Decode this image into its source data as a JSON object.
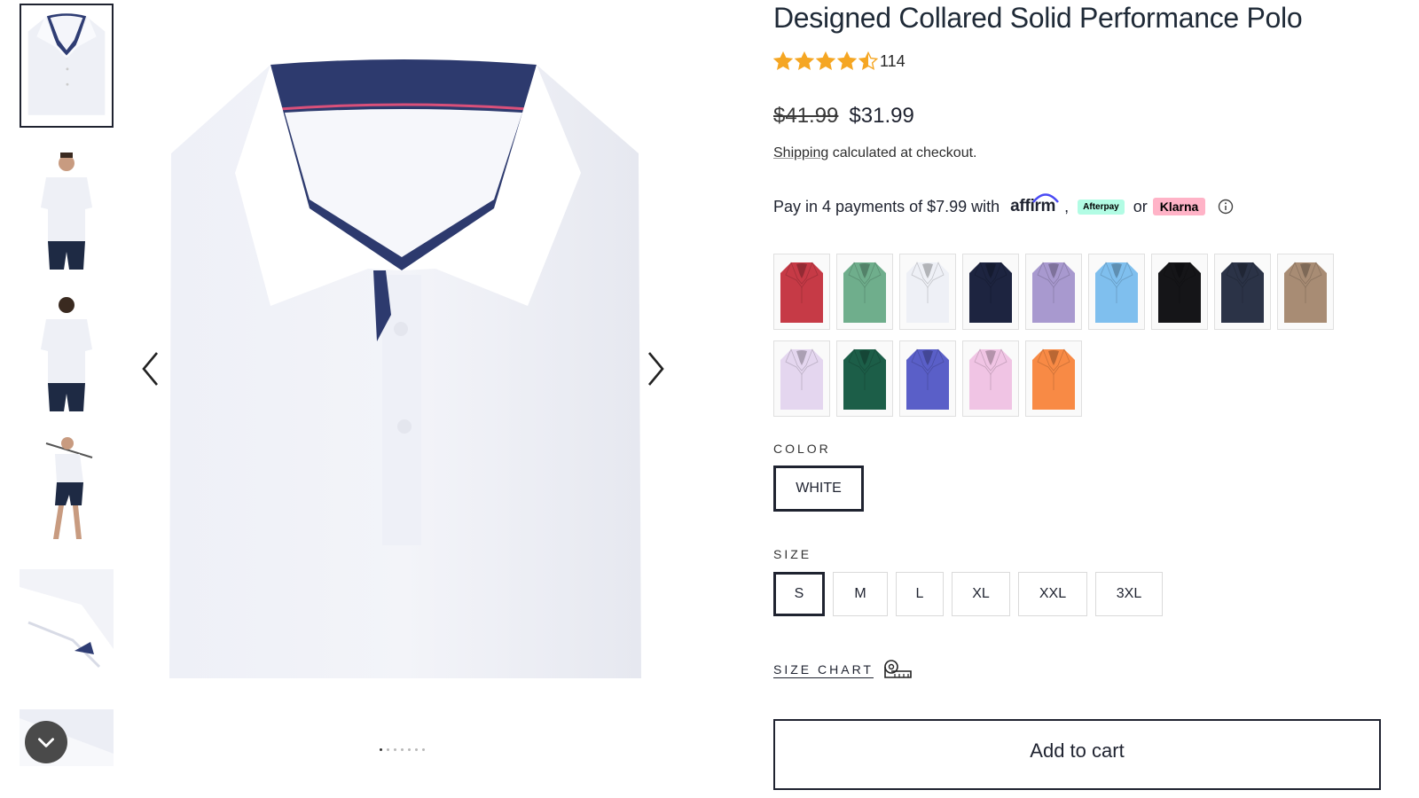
{
  "product": {
    "title": "Designed Collared Solid Performance Polo",
    "rating": 4.5,
    "review_count": "114",
    "price_original": "$41.99",
    "price_sale": "$31.99",
    "shipping_link": "Shipping",
    "shipping_text": " calculated at checkout."
  },
  "payment": {
    "text": "Pay in 4 payments of $7.99 with",
    "affirm": "affirm",
    "comma": ",",
    "afterpay": "Afterpay",
    "or": "or",
    "klarna": "Klarna",
    "info_icon": "info-icon"
  },
  "swatches": [
    {
      "name": "red",
      "color": "#c63a46"
    },
    {
      "name": "green",
      "color": "#6fae8c"
    },
    {
      "name": "white",
      "color": "#eef0f6"
    },
    {
      "name": "navy",
      "color": "#1d2440"
    },
    {
      "name": "lavender",
      "color": "#a899cf"
    },
    {
      "name": "sky-blue",
      "color": "#7fbfee"
    },
    {
      "name": "black",
      "color": "#151518"
    },
    {
      "name": "charcoal",
      "color": "#2b3347"
    },
    {
      "name": "khaki",
      "color": "#a88c74"
    },
    {
      "name": "light-lilac",
      "color": "#e4d6ef"
    },
    {
      "name": "forest-green",
      "color": "#1c5e48"
    },
    {
      "name": "royal-blue",
      "color": "#5a5fc8"
    },
    {
      "name": "pink",
      "color": "#f0c4e4"
    },
    {
      "name": "orange",
      "color": "#f88a45"
    }
  ],
  "color": {
    "label": "COLOR",
    "selected": "WHITE"
  },
  "size": {
    "label": "SIZE",
    "options": [
      "S",
      "M",
      "L",
      "XL",
      "XXL",
      "3XL"
    ],
    "selected": "S"
  },
  "size_chart": {
    "label": "SIZE CHART",
    "icon": "tape-measure-icon"
  },
  "cart": {
    "add_label": "Add to cart"
  },
  "gallery": {
    "thumbnail_count": 6,
    "dot_count": 7,
    "active_dot": 0
  },
  "colors": {
    "text": "#1f2330",
    "star": "#f5a623",
    "afterpay_bg": "#b2fce4",
    "klarna_bg": "#ffb3c7"
  }
}
